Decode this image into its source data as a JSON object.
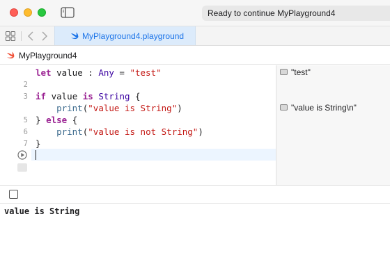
{
  "window": {
    "status": "Ready to continue MyPlayground4"
  },
  "tabs": [
    {
      "label": "MyPlayground4.playground",
      "icon": "swift-icon",
      "active": true
    }
  ],
  "breadcrumb": {
    "label": "MyPlayground4",
    "icon": "swift-icon"
  },
  "editor": {
    "line_numbers": [
      "2",
      "3",
      "5",
      "6",
      "7"
    ],
    "lines": [
      {
        "text": "let value : Any = \"test\""
      },
      {
        "text": ""
      },
      {
        "text": "if value is String {"
      },
      {
        "text": "    print(\"value is String\")"
      },
      {
        "text": "} else {"
      },
      {
        "text": "    print(\"value is not String\")"
      },
      {
        "text": "}"
      },
      {
        "text": ""
      }
    ]
  },
  "results": [
    {
      "text": "\"test\""
    },
    {
      "text": "\"value is String\\n\""
    }
  ],
  "console": {
    "output": "value is String"
  },
  "colors": {
    "keyword": "#9b2393",
    "type": "#3900a0",
    "function": "#3d6b8e",
    "string": "#c41a16",
    "tab_active": "#dcebfb",
    "current_line": "#ecf5ff"
  }
}
